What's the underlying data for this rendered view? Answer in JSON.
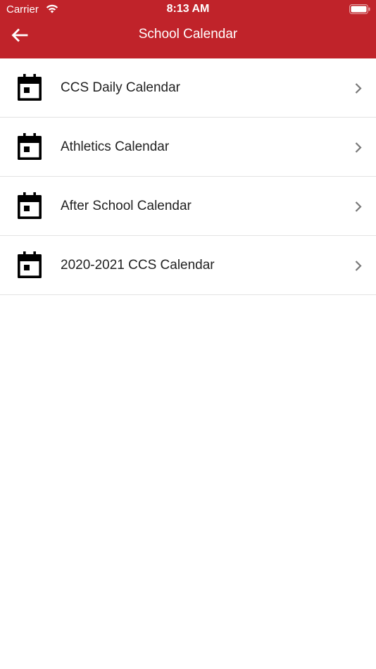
{
  "status_bar": {
    "carrier": "Carrier",
    "time": "8:13 AM",
    "wifi_icon": "wifi-icon",
    "battery_icon": "battery-icon"
  },
  "nav": {
    "title": "School Calendar",
    "back_icon": "arrow-left-icon"
  },
  "colors": {
    "header_bg": "#c0232a",
    "header_text": "#ffffff",
    "item_text": "#222222",
    "divider": "#e3e3e3",
    "chevron": "#777777"
  },
  "calendars": [
    {
      "label": "CCS Daily Calendar",
      "icon": "calendar-icon"
    },
    {
      "label": "Athletics Calendar",
      "icon": "calendar-icon"
    },
    {
      "label": "After School Calendar",
      "icon": "calendar-icon"
    },
    {
      "label": "2020-2021 CCS Calendar",
      "icon": "calendar-icon"
    }
  ]
}
